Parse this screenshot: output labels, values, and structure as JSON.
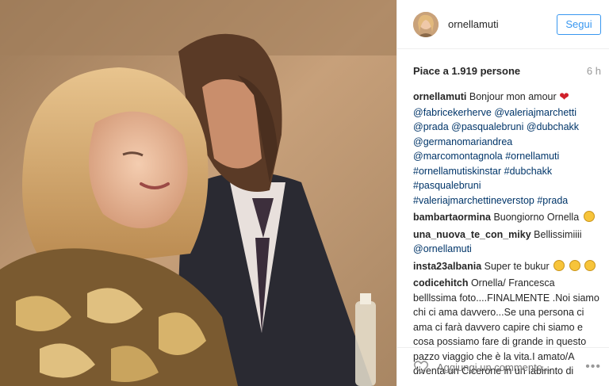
{
  "header": {
    "username": "ornellamuti",
    "follow_label": "Segui"
  },
  "post": {
    "likes": "Piace a 1.919 persone",
    "time": "6 h"
  },
  "caption": {
    "user": "ornellamuti",
    "text": "Bonjour mon amour",
    "tags": [
      "@fabricekerherve @valeriajmarchetti",
      "@prada @pasqualebruni @dubchakk",
      "@germanomariandrea",
      "@marcomontagnola #ornellamuti",
      "#ornellamutiskinstar #dubchakk",
      "#pasqualebruni",
      "#valeriajmarchettineverstop #prada"
    ]
  },
  "comments": [
    {
      "user": "bambartaormina",
      "text": "Buongiorno Ornella"
    },
    {
      "user": "una_nuova_te_con_miky",
      "text": "Bellissimiiii",
      "mention": "@ornellamuti"
    },
    {
      "user": "insta23albania",
      "text": "Super te bukur"
    },
    {
      "user": "codicehitch",
      "text": "Ornella/ Francesca belllssima foto....FINALMENTE .Noi siamo chi ci ama davvero...Se una persona ci ama ci farà davvero capire chi siamo e cosa possiamo fare di grande in questo pazzo viaggio che è la vita.I amato/A diventa un Cicerone in un labirinto di"
    }
  ],
  "footer": {
    "placeholder": "Aggiungi un commento...",
    "more": "•••"
  },
  "icons": {
    "heart": "heart-icon",
    "more": "more-options-icon"
  },
  "colors": {
    "accent": "#3897f0",
    "link": "#003569",
    "heart": "#d0202a"
  }
}
